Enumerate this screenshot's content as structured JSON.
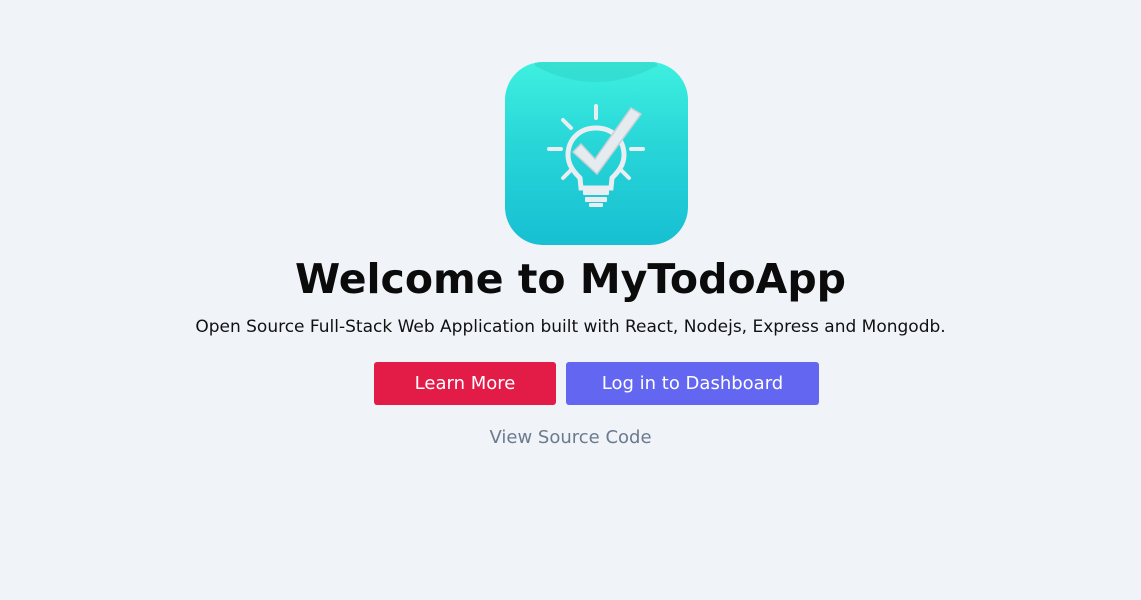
{
  "hero": {
    "logo_icon": "lightbulb-checkmark-icon",
    "title": "Welcome to MyTodoApp",
    "subtitle": "Open Source Full-Stack Web Application built with React, Nodejs, Express and Mongodb."
  },
  "actions": {
    "learn_more_label": "Learn More",
    "login_label": "Log in to Dashboard",
    "source_link_label": "View Source Code"
  },
  "colors": {
    "background": "#f0f3f8",
    "learn_more": "#e31b47",
    "login": "#6366f1",
    "link": "#6b7a8f",
    "logo_gradient_top": "#3ef0df",
    "logo_gradient_bottom": "#17bfd2"
  }
}
